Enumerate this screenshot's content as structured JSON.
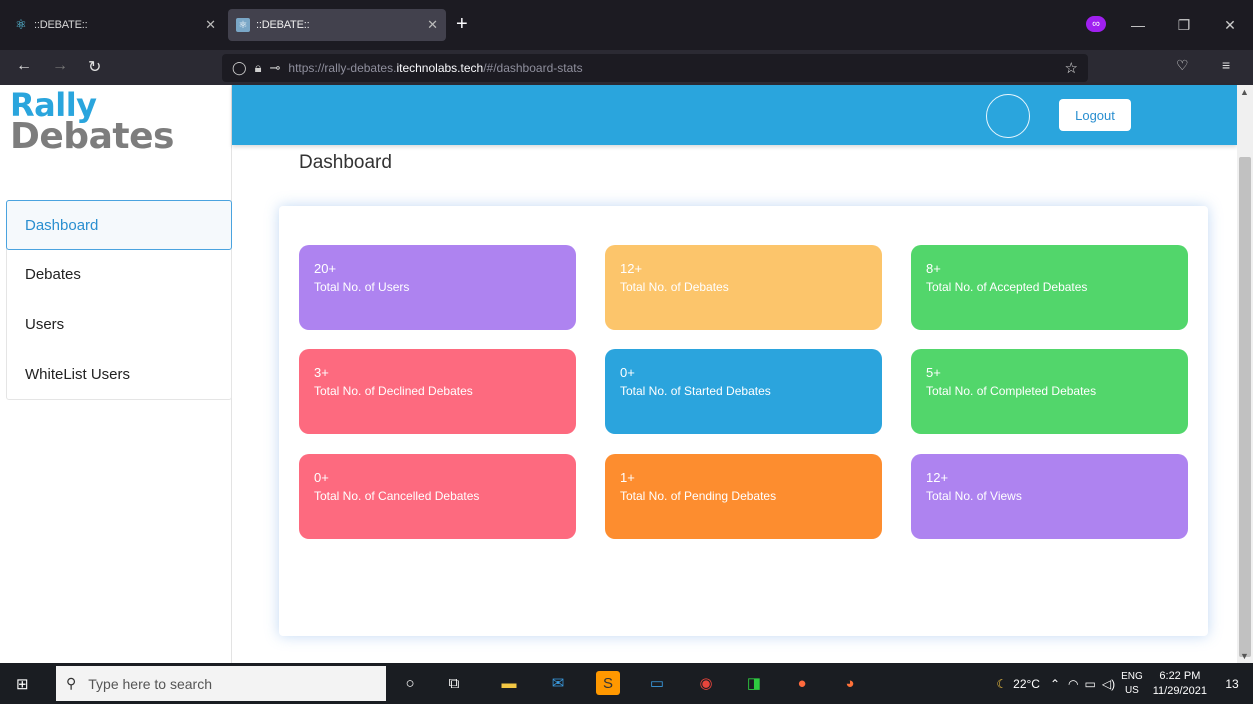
{
  "browser": {
    "tabs": [
      {
        "title": "::DEBATE::",
        "active": false
      },
      {
        "title": "::DEBATE::",
        "active": true
      }
    ],
    "new_tab": "+",
    "url_prefix": "https://rally-debates.",
    "url_domain": "itechnolabs.tech",
    "url_suffix": "/#/dashboard-stats"
  },
  "sidebar": {
    "logo_line1": "Rally",
    "logo_line2": "Debates",
    "items": [
      {
        "label": "Dashboard",
        "active": true
      },
      {
        "label": "Debates",
        "active": false
      },
      {
        "label": "Users",
        "active": false
      },
      {
        "label": "WhiteList Users",
        "active": false
      }
    ]
  },
  "header": {
    "logout_label": "Logout"
  },
  "main": {
    "title": "Dashboard",
    "cards": [
      {
        "value": "20+",
        "label": "Total No. of Users",
        "color": "#ae83f0"
      },
      {
        "value": "12+",
        "label": "Total No. of Debates",
        "color": "#fcc56b"
      },
      {
        "value": "8+",
        "label": "Total No. of Accepted Debates",
        "color": "#52d66b"
      },
      {
        "value": "3+",
        "label": "Total No. of Declined Debates",
        "color": "#fd6a7f"
      },
      {
        "value": "0+",
        "label": "Total No. of Started Debates",
        "color": "#2ba4dd"
      },
      {
        "value": "5+",
        "label": "Total No. of Completed Debates",
        "color": "#52d66b"
      },
      {
        "value": "0+",
        "label": "Total No. of Cancelled Debates",
        "color": "#fd6a7f"
      },
      {
        "value": "1+",
        "label": "Total No. of Pending Debates",
        "color": "#fd8d2f"
      },
      {
        "value": "12+",
        "label": "Total No. of Views",
        "color": "#ae83f0"
      }
    ]
  },
  "taskbar": {
    "search_placeholder": "Type here to search",
    "weather": "22°C",
    "lang_top": "ENG",
    "lang_bottom": "US",
    "time": "6:22 PM",
    "date": "11/29/2021",
    "notifications": "13"
  }
}
